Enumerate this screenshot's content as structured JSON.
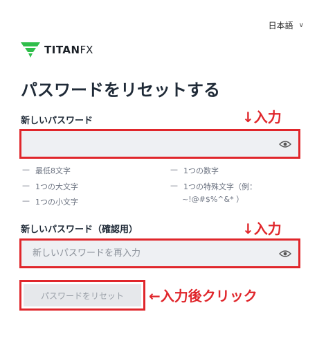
{
  "header": {
    "language": "日本語"
  },
  "brand": {
    "name": "TITAN",
    "suffix": "FX"
  },
  "page": {
    "title": "パスワードをリセットする"
  },
  "form": {
    "new_password_label": "新しいパスワード",
    "new_password_value": "",
    "requirements": [
      "最低8文字",
      "1つの数字",
      "1つの大文字",
      "1つの特殊文字（例：",
      "~!@#$%^&* ）",
      "1つの小文字"
    ],
    "confirm_label": "新しいパスワード（確認用）",
    "confirm_placeholder": "新しいパスワードを再入力",
    "reset_button": "パスワードをリセット"
  },
  "annotations": {
    "input1": "↓入力",
    "input2": "↓入力",
    "click": "←入力後クリック"
  },
  "colors": {
    "annotation": "#e0262b",
    "brand_green": "#2fbe4a"
  }
}
